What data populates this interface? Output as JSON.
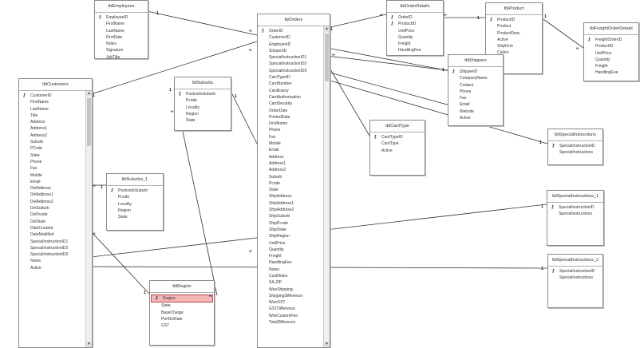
{
  "tables": [
    {
      "id": "tblEmployees",
      "title": "tblEmployees",
      "fields": [
        "EmployeeID",
        "FirstName",
        "LastName",
        "FirstDate",
        "Notes",
        "Signature",
        "JobTitle"
      ],
      "keys": [
        0
      ]
    },
    {
      "id": "tblOrderDetails",
      "title": "tblOrderDetails",
      "fields": [
        "OrderID",
        "ProductID",
        "UnitPrice",
        "Quantity",
        "Freight",
        "HandlingFee"
      ],
      "keys": [
        0,
        1
      ]
    },
    {
      "id": "tblProduct",
      "title": "tblProduct",
      "fields": [
        "ProductID",
        "Product",
        "ProductDesc",
        "Active",
        "ShipFirst",
        "Colors"
      ],
      "keys": [
        0
      ]
    },
    {
      "id": "tblFreightOrderDetails",
      "title": "tblFreightOrderDetails",
      "fields": [
        "FreightOrderID",
        "ProductID",
        "UnitPrice",
        "Quantity",
        "Freight",
        "HandlingFee"
      ],
      "keys": [
        0
      ]
    },
    {
      "id": "tblOrders",
      "title": "tblOrders",
      "fields": [
        "OrderID",
        "CustomerID",
        "EmployeeID",
        "ShipperID",
        "SpecialInstructionID1",
        "SpecialInstructionID2",
        "SpecialInstructionID3",
        "CardTypeID",
        "CardNumber",
        "CardExpiry",
        "CardAuthorization",
        "CardSecurity",
        "OrderDate",
        "PrintedDate",
        "FirstName",
        "Phone",
        "Fax",
        "Mobile",
        "Email",
        "Address",
        "Address1",
        "Address2",
        "Suburb",
        "Pcode",
        "State",
        "ShipAddress",
        "ShipAddress1",
        "ShipAddress2",
        "ShipSuburb",
        "ShipPcode",
        "ShipState",
        "ShipRegion",
        "UnitPrice",
        "Quantity",
        "Freight",
        "HandlingFee",
        "Notes",
        "CustNotes",
        "SA-ZIP",
        "WeeShipping",
        "ShippingDifference",
        "WeeGST",
        "GSTDifference",
        "WeeCustomFee",
        "TotalDifference"
      ],
      "keys": [
        0
      ]
    },
    {
      "id": "tblShippers",
      "title": "tblShippers",
      "fields": [
        "ShipperID",
        "CompanyName",
        "Contact",
        "Phone",
        "Fax",
        "Email",
        "Website",
        "Active"
      ],
      "keys": [
        0
      ]
    },
    {
      "id": "tblCustomers",
      "title": "tblCustomers",
      "fields": [
        "CustomerID",
        "FirstName",
        "LastName",
        "Title",
        "Address",
        "Address1",
        "Address2",
        "Suburb",
        "PCode",
        "State",
        "Phone",
        "Fax",
        "Mobile",
        "Email",
        "DelAddress",
        "DelAddress1",
        "DelAddress2",
        "DelSuburb",
        "DelPcode",
        "DelState",
        "DateCreated",
        "DateModified",
        "SpecialInstructionID1",
        "SpecialInstructionID2",
        "SpecialInstructionID3",
        "Notes",
        "Active"
      ],
      "keys": [
        0
      ]
    },
    {
      "id": "tblSuburbs",
      "title": "tblSuburbs",
      "fields": [
        "PostcodeSuburb",
        "Pcode",
        "Locality",
        "Region",
        "State"
      ],
      "keys": [
        0
      ]
    },
    {
      "id": "tblCardType",
      "title": "tblCardType",
      "fields": [
        "CardTypeID",
        "CardType",
        "Active"
      ],
      "keys": [
        0
      ]
    },
    {
      "id": "tblSuburbs_1",
      "title": "tblSuburbs_1",
      "fields": [
        "PostcodeSuburb",
        "Pcode",
        "Locality",
        "Region",
        "State"
      ],
      "keys": [
        0
      ]
    },
    {
      "id": "tblSpecialInstructions",
      "title": "tblSpecialInstructions",
      "fields": [
        "SpecialInstructionID",
        "SpecialInstructions"
      ],
      "keys": [
        0
      ]
    },
    {
      "id": "tblSpecialInstructions_1",
      "title": "tblSpecialInstructions_1",
      "fields": [
        "SpecialInstructionID",
        "SpecialInstructions"
      ],
      "keys": [
        0
      ]
    },
    {
      "id": "tblSpecialInstructions_2",
      "title": "tblSpecialInstructions_2",
      "fields": [
        "SpecialInstructionID",
        "SpecialInstructions"
      ],
      "keys": [
        0
      ]
    },
    {
      "id": "tblRegion",
      "title": "tblRegion",
      "fields": [
        "Region",
        "State",
        "BaseCharge",
        "PerKiloRate",
        "GST"
      ],
      "keys": [
        0
      ],
      "selected": 0
    }
  ],
  "relationships": [
    {
      "from": "tblEmployees",
      "to": "tblOrders",
      "one": "1",
      "many": "∞"
    },
    {
      "from": "tblOrders",
      "to": "tblOrderDetails",
      "one": "1",
      "many": "∞"
    },
    {
      "from": "tblOrderDetails",
      "to": "tblProduct",
      "one": "∞",
      "many": "1"
    },
    {
      "from": "tblProduct",
      "to": "tblFreightOrderDetails",
      "one": "1",
      "many": "∞"
    },
    {
      "from": "tblOrders",
      "to": "tblShippers",
      "one": "∞",
      "many": "1"
    },
    {
      "from": "tblCustomers",
      "to": "tblOrders",
      "one": "1",
      "many": "∞"
    },
    {
      "from": "tblOrders",
      "to": "tblCardType",
      "one": "∞",
      "many": "1"
    },
    {
      "from": "tblSuburbs",
      "to": "tblOrders",
      "one": "1",
      "many": "∞"
    },
    {
      "from": "tblCustomers",
      "to": "tblSuburbs_1",
      "one": "∞",
      "many": "1"
    },
    {
      "from": "tblOrders",
      "to": "tblSpecialInstructions",
      "one": "∞",
      "many": "1"
    },
    {
      "from": "tblCustomers",
      "to": "tblSpecialInstructions_1",
      "one": "∞",
      "many": "1"
    },
    {
      "from": "tblCustomers",
      "to": "tblSpecialInstructions_2",
      "one": "∞",
      "many": "1"
    },
    {
      "from": "tblCustomers",
      "to": "tblRegion",
      "one": "∞",
      "many": "1"
    }
  ],
  "icons": {
    "key": "key-icon",
    "scroll_up": "scroll-up-icon",
    "scroll_down": "scroll-down-icon"
  },
  "colors": {
    "selected_row": "#f4b6b6",
    "selected_border": "#c24a4a",
    "line": "#333333"
  }
}
